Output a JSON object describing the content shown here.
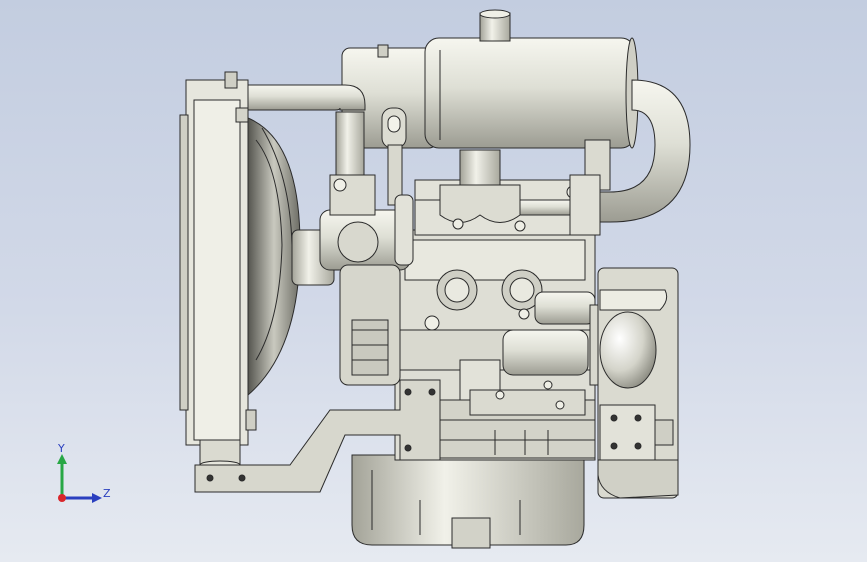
{
  "viewport": {
    "background_top": "#c3cde0",
    "background_bottom": "#e6eaf1",
    "model_fill": "#e4e4db",
    "model_shade": "#b9b9ae",
    "model_stroke": "#2b2b2b"
  },
  "triad": {
    "y_label": "Y",
    "z_label": "Z",
    "y_color": "#28a745",
    "z_color": "#2a3fbf",
    "origin_color": "#d9262b"
  }
}
